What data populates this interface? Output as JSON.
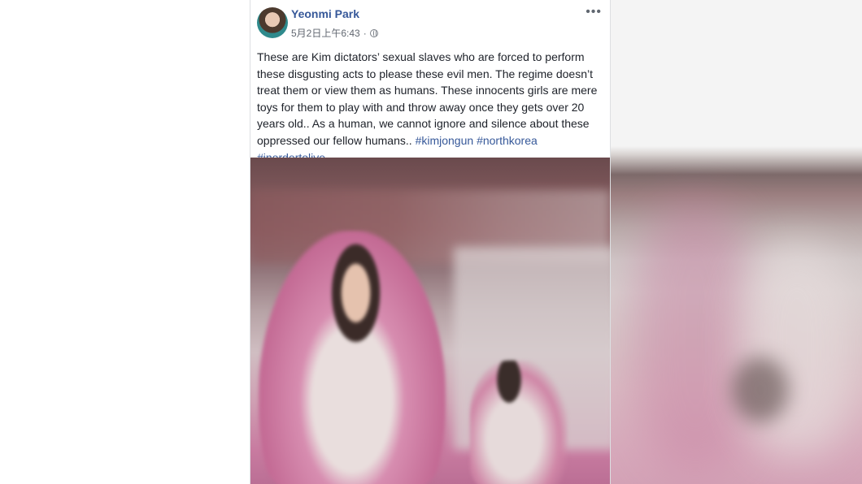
{
  "post": {
    "author": "Yeonmi Park",
    "timestamp": "5月2日上午6:43",
    "separator": "·",
    "privacy_icon": "globe-icon",
    "more_label": "•••",
    "body": "These are Kim dictators’ sexual slaves who are forced to perform these disgusting acts to please these evil men. The regime doesn’t treat them or view them as humans. These innocents girls are mere toys for them to play with and throw away once they gets over 20 years old.. As a human, we cannot ignore and silence about these oppressed our fellow humans..",
    "hashtags": [
      "#kimjongun",
      "#northkorea",
      "#inordertolive"
    ]
  },
  "colors": {
    "author_link": "#365899",
    "body_text": "#1d2129",
    "meta_text": "#616770"
  }
}
